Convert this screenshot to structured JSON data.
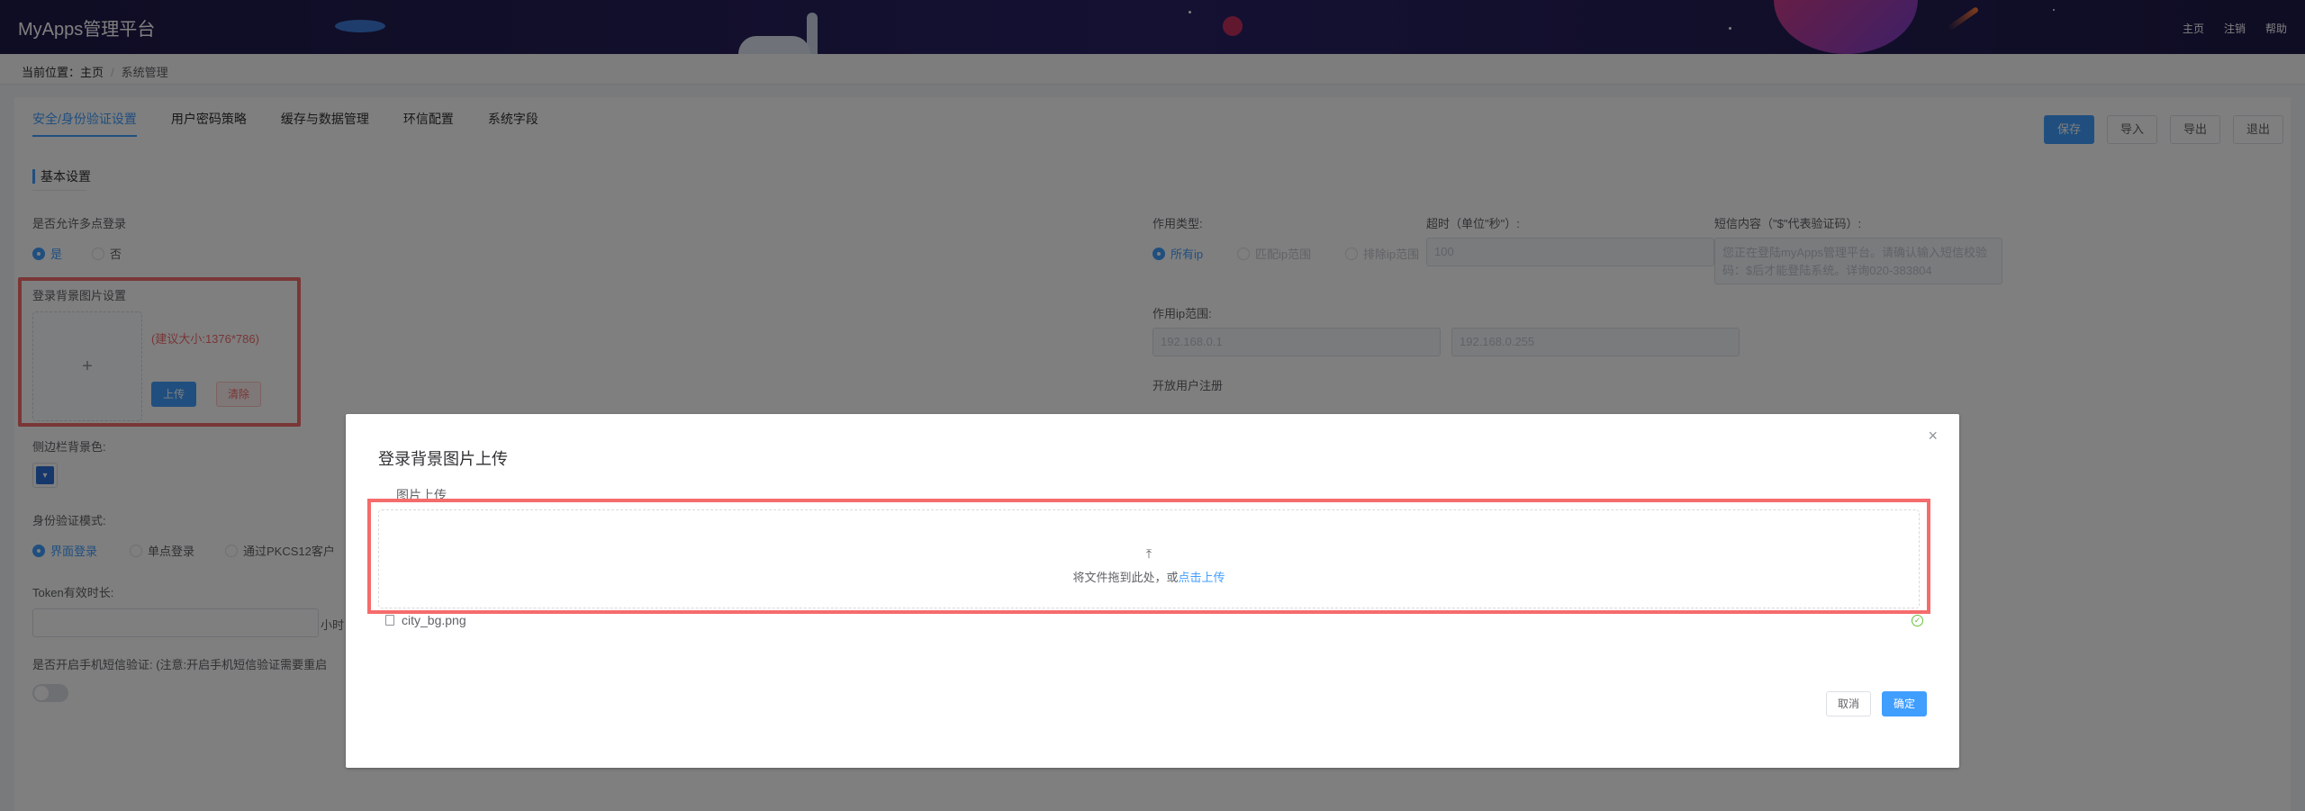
{
  "header": {
    "brand": "MyApps管理平台",
    "nav": [
      "主页",
      "注销",
      "帮助"
    ]
  },
  "breadcrumb": {
    "prefix": "当前位置：",
    "home": "主页",
    "sep": "/",
    "current": "系统管理"
  },
  "tabs": [
    "安全/身份验证设置",
    "用户密码策略",
    "缓存与数据管理",
    "环信配置",
    "系统字段"
  ],
  "actions": [
    "保存",
    "导入",
    "导出",
    "退出"
  ],
  "section": {
    "title": "基本设置"
  },
  "left": {
    "multi_login_label": "是否允许多点登录",
    "multi_login_yes": "是",
    "multi_login_no": "否",
    "bg_label": "登录背景图片设置",
    "bg_plus": "+",
    "bg_hint": "(建议大小:1376*786)",
    "bg_upload": "上传",
    "bg_clear": "清除",
    "sidebar_color_label": "侧边栏背景色:",
    "auth_mode_label": "身份验证模式:",
    "auth_modes": [
      "界面登录",
      "单点登录",
      "通过PKCS12客户"
    ],
    "token_label": "Token有效时长:",
    "token_unit": "小时",
    "sms_label": "是否开启手机短信验证: (注意:开启手机短信验证需要重启"
  },
  "right": {
    "type_label": "作用类型:",
    "types": [
      "所有ip",
      "匹配ip范围",
      "排除ip范围"
    ],
    "timeout_label": "超时（单位\"秒\"）:",
    "timeout_value": "100",
    "sms_content_label": "短信内容（\"$\"代表验证码）:",
    "sms_content_value": "您正在登陆myApps管理平台。请确认输入短信校验码：$后才能登陆系统。详询020-383804",
    "ip_range_label": "作用ip范围:",
    "ip_start": "192.168.0.1",
    "ip_end": "192.168.0.255",
    "register_label": "开放用户注册"
  },
  "dialog": {
    "title": "登录背景图片上传",
    "close": "×",
    "upload_label": "图片上传",
    "drop_icon": "⤒",
    "drop_text": "将文件拖到此处，或",
    "drop_link": "点击上传",
    "file_name": "city_bg.png",
    "ok_icon": "✓",
    "cancel": "取消",
    "confirm": "确定"
  },
  "colors": {
    "primary": "#409eff",
    "highlight": "#f56c6c",
    "header_bg": "#1e1a47"
  }
}
